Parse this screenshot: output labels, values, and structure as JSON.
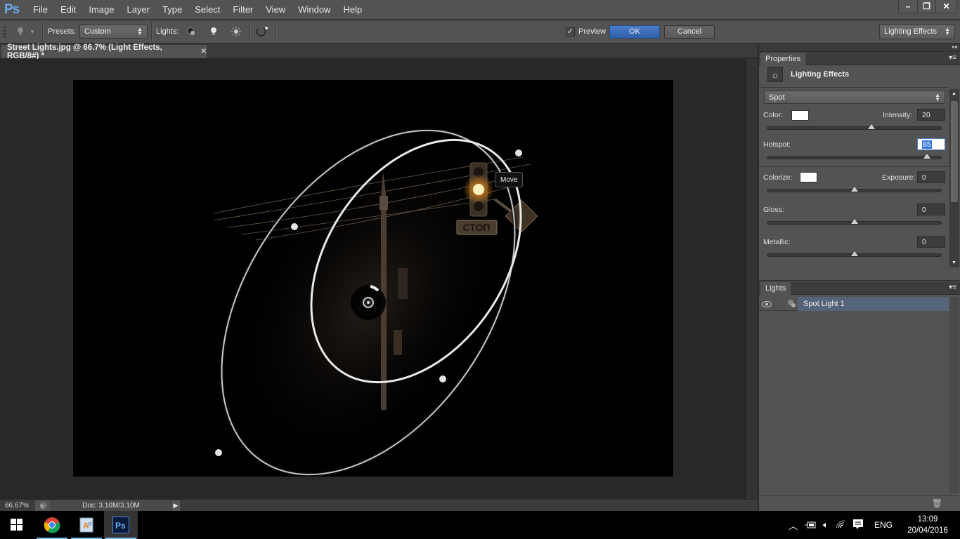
{
  "app": {
    "logo": "Ps",
    "menu": [
      "File",
      "Edit",
      "Image",
      "Layer",
      "Type",
      "Select",
      "Filter",
      "View",
      "Window",
      "Help"
    ],
    "window_controls": {
      "minimize": "–",
      "restore": "❐",
      "close": "✕"
    }
  },
  "options_bar": {
    "presets_label": "Presets:",
    "presets_value": "Custom",
    "lights_label": "Lights:",
    "light_tools": [
      "point-light-icon",
      "spot-light-icon",
      "infinite-light-icon"
    ],
    "reset_icon": "reset-light-icon",
    "preview_label": "Preview",
    "preview_checked": true,
    "ok_label": "OK",
    "cancel_label": "Cancel",
    "workspace_value": "Lighting Effects"
  },
  "document": {
    "tab_title": "Street Lights.jpg @ 66.7% (Light Effects, RGB/8#) *",
    "tooltip": "Move",
    "image_sign_text": "СТОП"
  },
  "status_bar": {
    "zoom": "66.67%",
    "doc_info": "Doc: 3.10M/3.10M"
  },
  "properties_panel": {
    "tab_label": "Properties",
    "header_title": "Lighting Effects",
    "light_type": "Spot",
    "color_label": "Color:",
    "color_value": "#ffffff",
    "intensity_label": "Intensity:",
    "intensity_value": "20",
    "intensity_slider_fraction": 0.6,
    "hotspot_label": "Hotspot:",
    "hotspot_value": "85",
    "hotspot_slider_fraction": 0.92,
    "colorize_label": "Colorize:",
    "colorize_value": "#ffffff",
    "exposure_label": "Exposure:",
    "exposure_value": "0",
    "exposure_slider_fraction": 0.5,
    "gloss_label": "Gloss:",
    "gloss_value": "0",
    "gloss_slider_fraction": 0.5,
    "metallic_label": "Metallic:",
    "metallic_value": "0",
    "metallic_slider_fraction": 0.5
  },
  "lights_panel": {
    "tab_label": "Lights",
    "items": [
      {
        "name": "Spot Light 1",
        "visible": true,
        "selected": true
      }
    ]
  },
  "taskbar": {
    "apps": [
      "start",
      "chrome",
      "wordpad",
      "photoshop"
    ],
    "active_app": "photoshop",
    "language": "ENG",
    "time": "13:09",
    "date": "20/04/2016"
  },
  "colors": {
    "accent": "#2f5fa8",
    "selection": "#56647a",
    "panel_bg": "#535353"
  }
}
